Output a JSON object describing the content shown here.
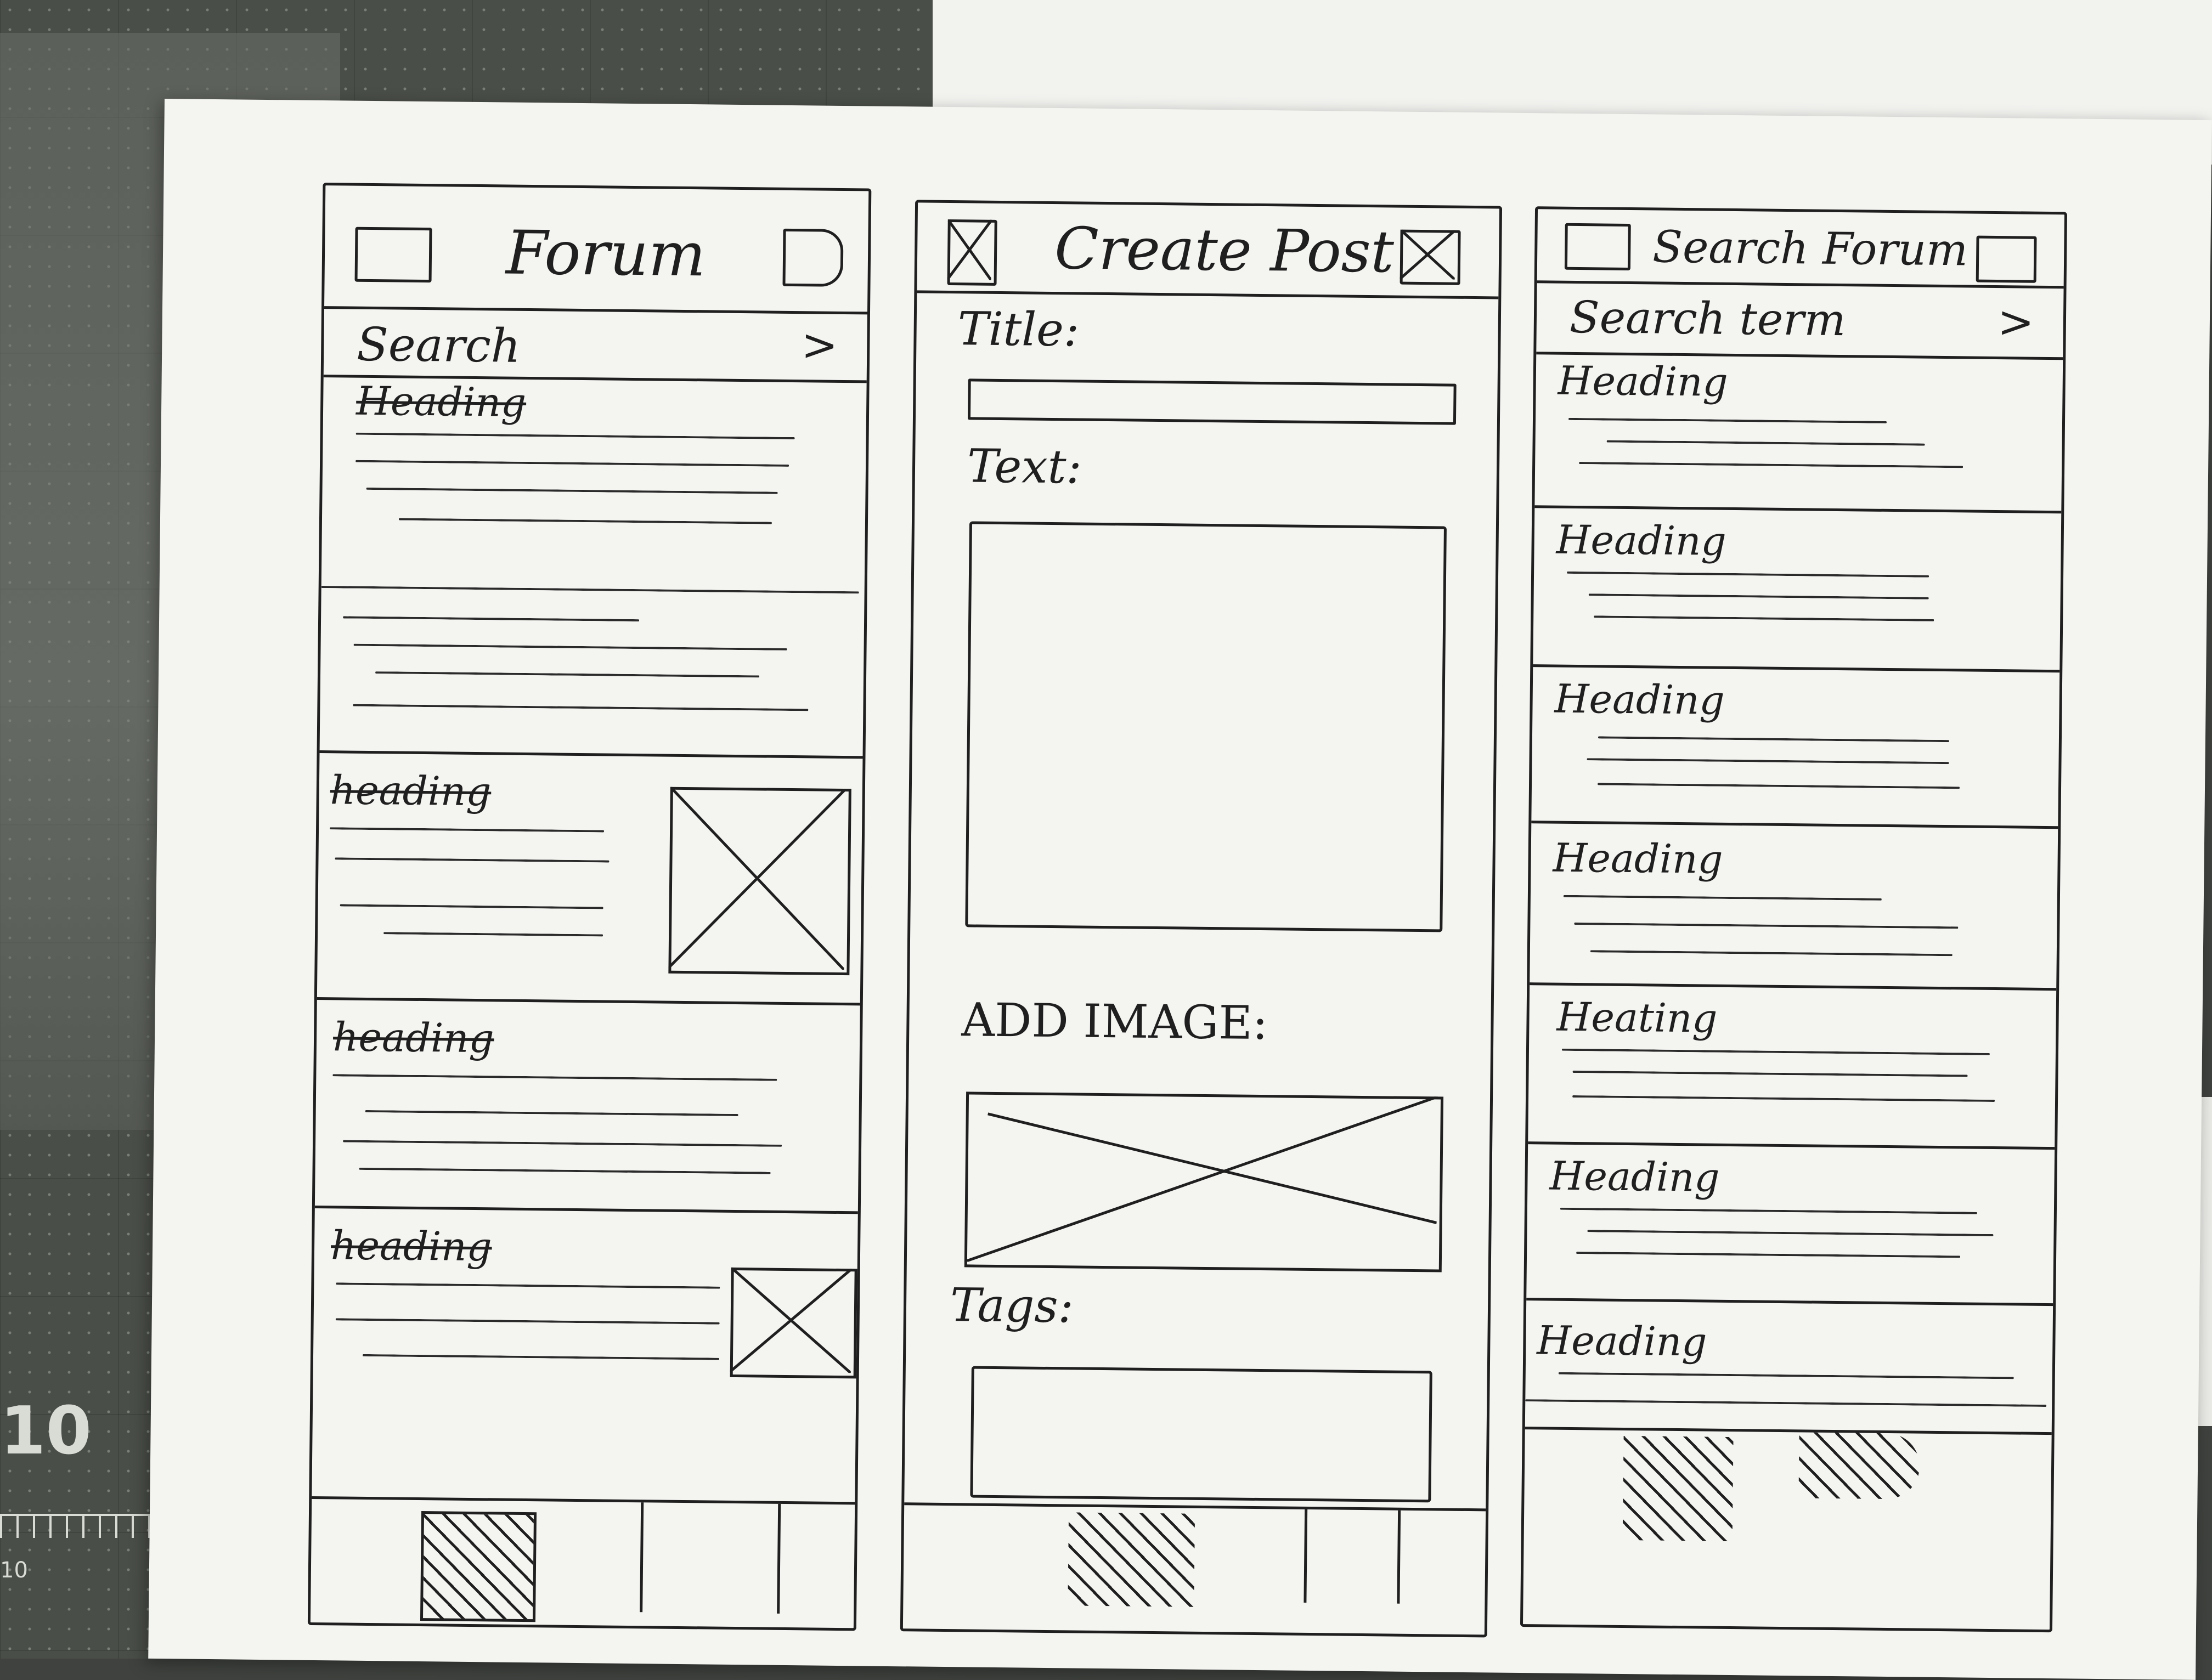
{
  "sketch1": {
    "title": "Forum",
    "search_label": "Search",
    "search_arrow": ">",
    "posts": [
      {
        "heading": "Heading"
      },
      {
        "heading": "heading"
      },
      {
        "heading": "heading"
      },
      {
        "heading": "heading"
      }
    ]
  },
  "sketch2": {
    "title": "Create Post",
    "title_label": "Title:",
    "text_label": "Text:",
    "image_label": "ADD IMAGE:",
    "tags_label": "Tags:"
  },
  "sketch3": {
    "title": "Search Forum",
    "search_label": "Search term",
    "search_arrow": ">",
    "results": [
      {
        "heading": "Heading"
      },
      {
        "heading": "Heading"
      },
      {
        "heading": "Heading"
      },
      {
        "heading": "Heading"
      },
      {
        "heading": "Heating"
      },
      {
        "heading": "Heading"
      },
      {
        "heading": "Heading"
      }
    ]
  },
  "mat": {
    "number": "10",
    "ruler_label": "10"
  },
  "colors": {
    "ink": "#1f1f1f",
    "paper": "#f4f4f1",
    "mat": "#4a4e48"
  }
}
